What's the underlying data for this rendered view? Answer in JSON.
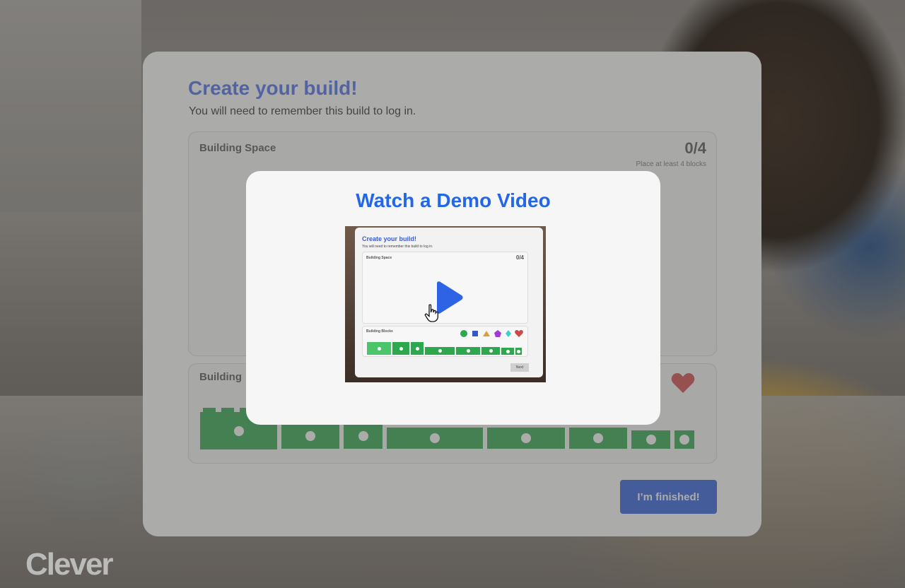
{
  "page": {
    "brand": "Clever"
  },
  "card": {
    "title": "Create your build!",
    "subtitle": "You will need to remember this build to log in.",
    "building_space": {
      "label": "Building Space",
      "count": "0/4",
      "hint": "Place at least 4 blocks"
    },
    "building_blocks": {
      "label": "Building"
    },
    "finish_button": "I’m finished!"
  },
  "modal": {
    "title": "Watch a Demo Video",
    "video_preview": {
      "title": "Create your build!",
      "subtitle": "You will need to remember this build to log in.",
      "building_space_label": "Building Space",
      "count": "0/4",
      "building_blocks_label": "Building Blocks",
      "next_label": "Next"
    }
  },
  "colors": {
    "accent_blue": "#2267e8",
    "title_blue": "#4a6df0",
    "button_blue": "#2f5fe0",
    "block_green": "#2ea84f",
    "heart_red": "#d64545"
  },
  "icons": [
    "heart-icon",
    "play-icon",
    "hand-cursor-icon",
    "circle-shape-icon",
    "square-shape-icon",
    "triangle-shape-icon",
    "pentagon-shape-icon",
    "diamond-shape-icon"
  ]
}
